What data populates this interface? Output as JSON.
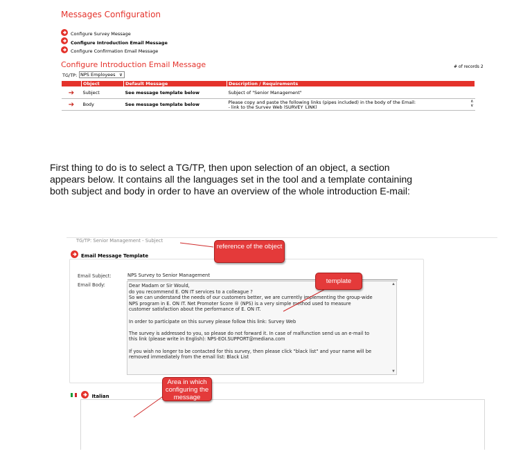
{
  "top_section": {
    "title": "Messages Configuration",
    "links": [
      {
        "label": "Configure Survey Message",
        "bold": false
      },
      {
        "label": "Configure Introduction Email Message",
        "bold": true
      },
      {
        "label": "Configure Confirmation Email Message",
        "bold": false
      }
    ],
    "subtitle": "Configure Introduction Email Message",
    "records": "# of records 2",
    "tg_label": "TG/TP:",
    "tg_select": "NPS Employees",
    "table": {
      "headers": [
        "",
        "Object",
        "Default Message",
        "Description / Requirements"
      ],
      "rows": [
        {
          "object": "Subject",
          "default": "See message template below",
          "desc": "Subject of \"Senior Management\""
        },
        {
          "object": "Body",
          "default": "See message template below",
          "desc": "Please copy and paste the following links (pipes included) in the body of the Email:",
          "desc2": "- link to the Survey Web |SURVEY_LINK|"
        }
      ]
    }
  },
  "paragraph": [
    "First thing to do is to select a TG/TP, then upon selection of an object, a section",
    "appears below. It contains all the languages set in the tool and a template containing",
    "both subject and body in order to have an overview of the whole introduction E-mail:"
  ],
  "bottom_section": {
    "header": "TG/TP: Senior Management - Subject",
    "template_title": "Email Message Template",
    "subject_label": "Email Subject:",
    "subject_value": "NPS Survey to Senior Management",
    "body_label": "Email Body:",
    "body_text": "Dear Madam or Sir Would,\ndo you recommend E. ON IT services to a colleague ?\nSo we can understand the needs of our customers better, we are currently implementing the group-wide\nNPS program in E. ON IT. Net Promoter Score ® (NPS) is a very simple method used to measure\ncustomer satisfaction about the performance of E. ON IT.\n\nIn order to participate on this survey please follow this link: Survey Web\n\nThe survey is addressed to you, so please do not forward it. In case of malfunction send us an e-mail to\nthis link (please write in English): NPS-EOI.SUPPORT@mediana.com\n\nIf you wish no longer to be contacted for this survey, then please click \"black list\" and your name will be\nremoved immediately from the email list: Black List",
    "language": "Italian",
    "callouts": {
      "reference": "reference of the object",
      "template": "template",
      "area": "Area in which configuring the message"
    }
  },
  "colors": {
    "accent": "#e4322b",
    "callout": "#e43a3a"
  }
}
